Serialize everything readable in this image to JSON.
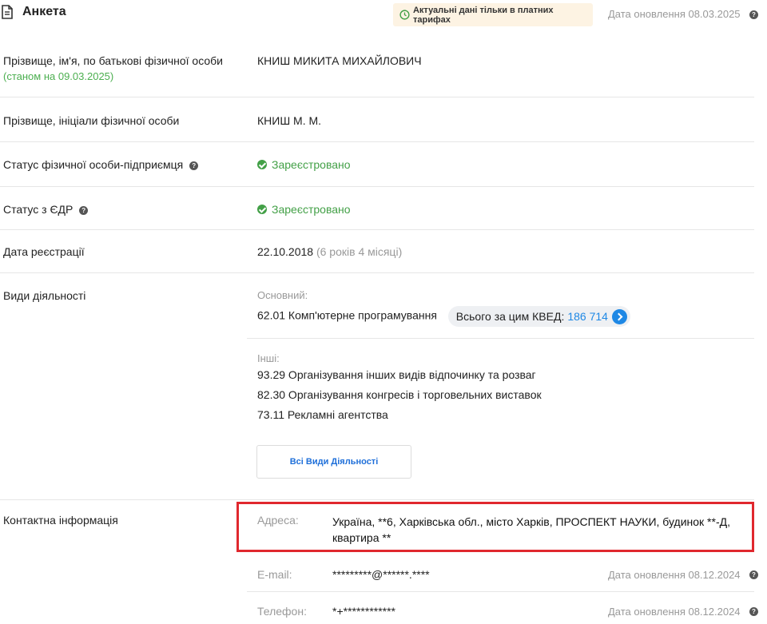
{
  "header": {
    "title": "Анкета",
    "badge": "Актуальні дані тільки в платних тарифах",
    "update": "Дата оновлення 08.03.2025"
  },
  "rows": {
    "fullname": {
      "label": "Прізвище, ім'я, по батькові фізичної особи",
      "sub": "(станом на 09.03.2025)",
      "value": "КНИШ МИКИТА МИХАЙЛОВИЧ"
    },
    "initials": {
      "label": "Прізвище, ініціали фізичної особи",
      "value": "КНИШ М. М."
    },
    "status_fop": {
      "label": "Статус фізичної особи-підприємця",
      "value": "Зареєстровано"
    },
    "status_edr": {
      "label": "Статус з ЄДР",
      "value": "Зареєстровано"
    },
    "reg_date": {
      "label": "Дата реєстрації",
      "value": "22.10.2018",
      "duration": "(6 років 4 місяці)"
    },
    "activities": {
      "label": "Види діяльності",
      "main_heading": "Основний:",
      "main": "62.01 Комп'ютерне програмування",
      "kved_total_label": "Всього за цим КВЕД:",
      "kved_total": "186 714",
      "other_heading": "Інші:",
      "others": [
        "93.29 Організування інших видів відпочинку та розваг",
        "82.30 Організування конгресів і торговельних виставок",
        "73.11 Рекламні агентства"
      ],
      "all_button": "Всі Види Діяльності"
    },
    "contacts": {
      "label": "Контактна інформація",
      "address_label": "Адреса:",
      "address_line1": "Україна, **6, Харківська обл., місто Харків, ПРОСПЕКТ НАУКИ, будинок **-Д,",
      "address_line2": "квартира **",
      "email_label": "E-mail:",
      "email": "*********@******.****",
      "email_update": "Дата оновлення 08.12.2024",
      "phone_label": "Телефон:",
      "phone": "*+************",
      "phone_update": "Дата оновлення 08.12.2024"
    }
  },
  "icons": {
    "document": "document-icon",
    "clock": "clock-icon",
    "help": "help-icon",
    "check": "check-circle-icon",
    "arrow": "chevron-right-icon"
  },
  "colors": {
    "accent_blue": "#1e88e5",
    "green": "#43a047",
    "highlight_red": "#e0282e",
    "badge_bg": "#fdf3e3"
  }
}
